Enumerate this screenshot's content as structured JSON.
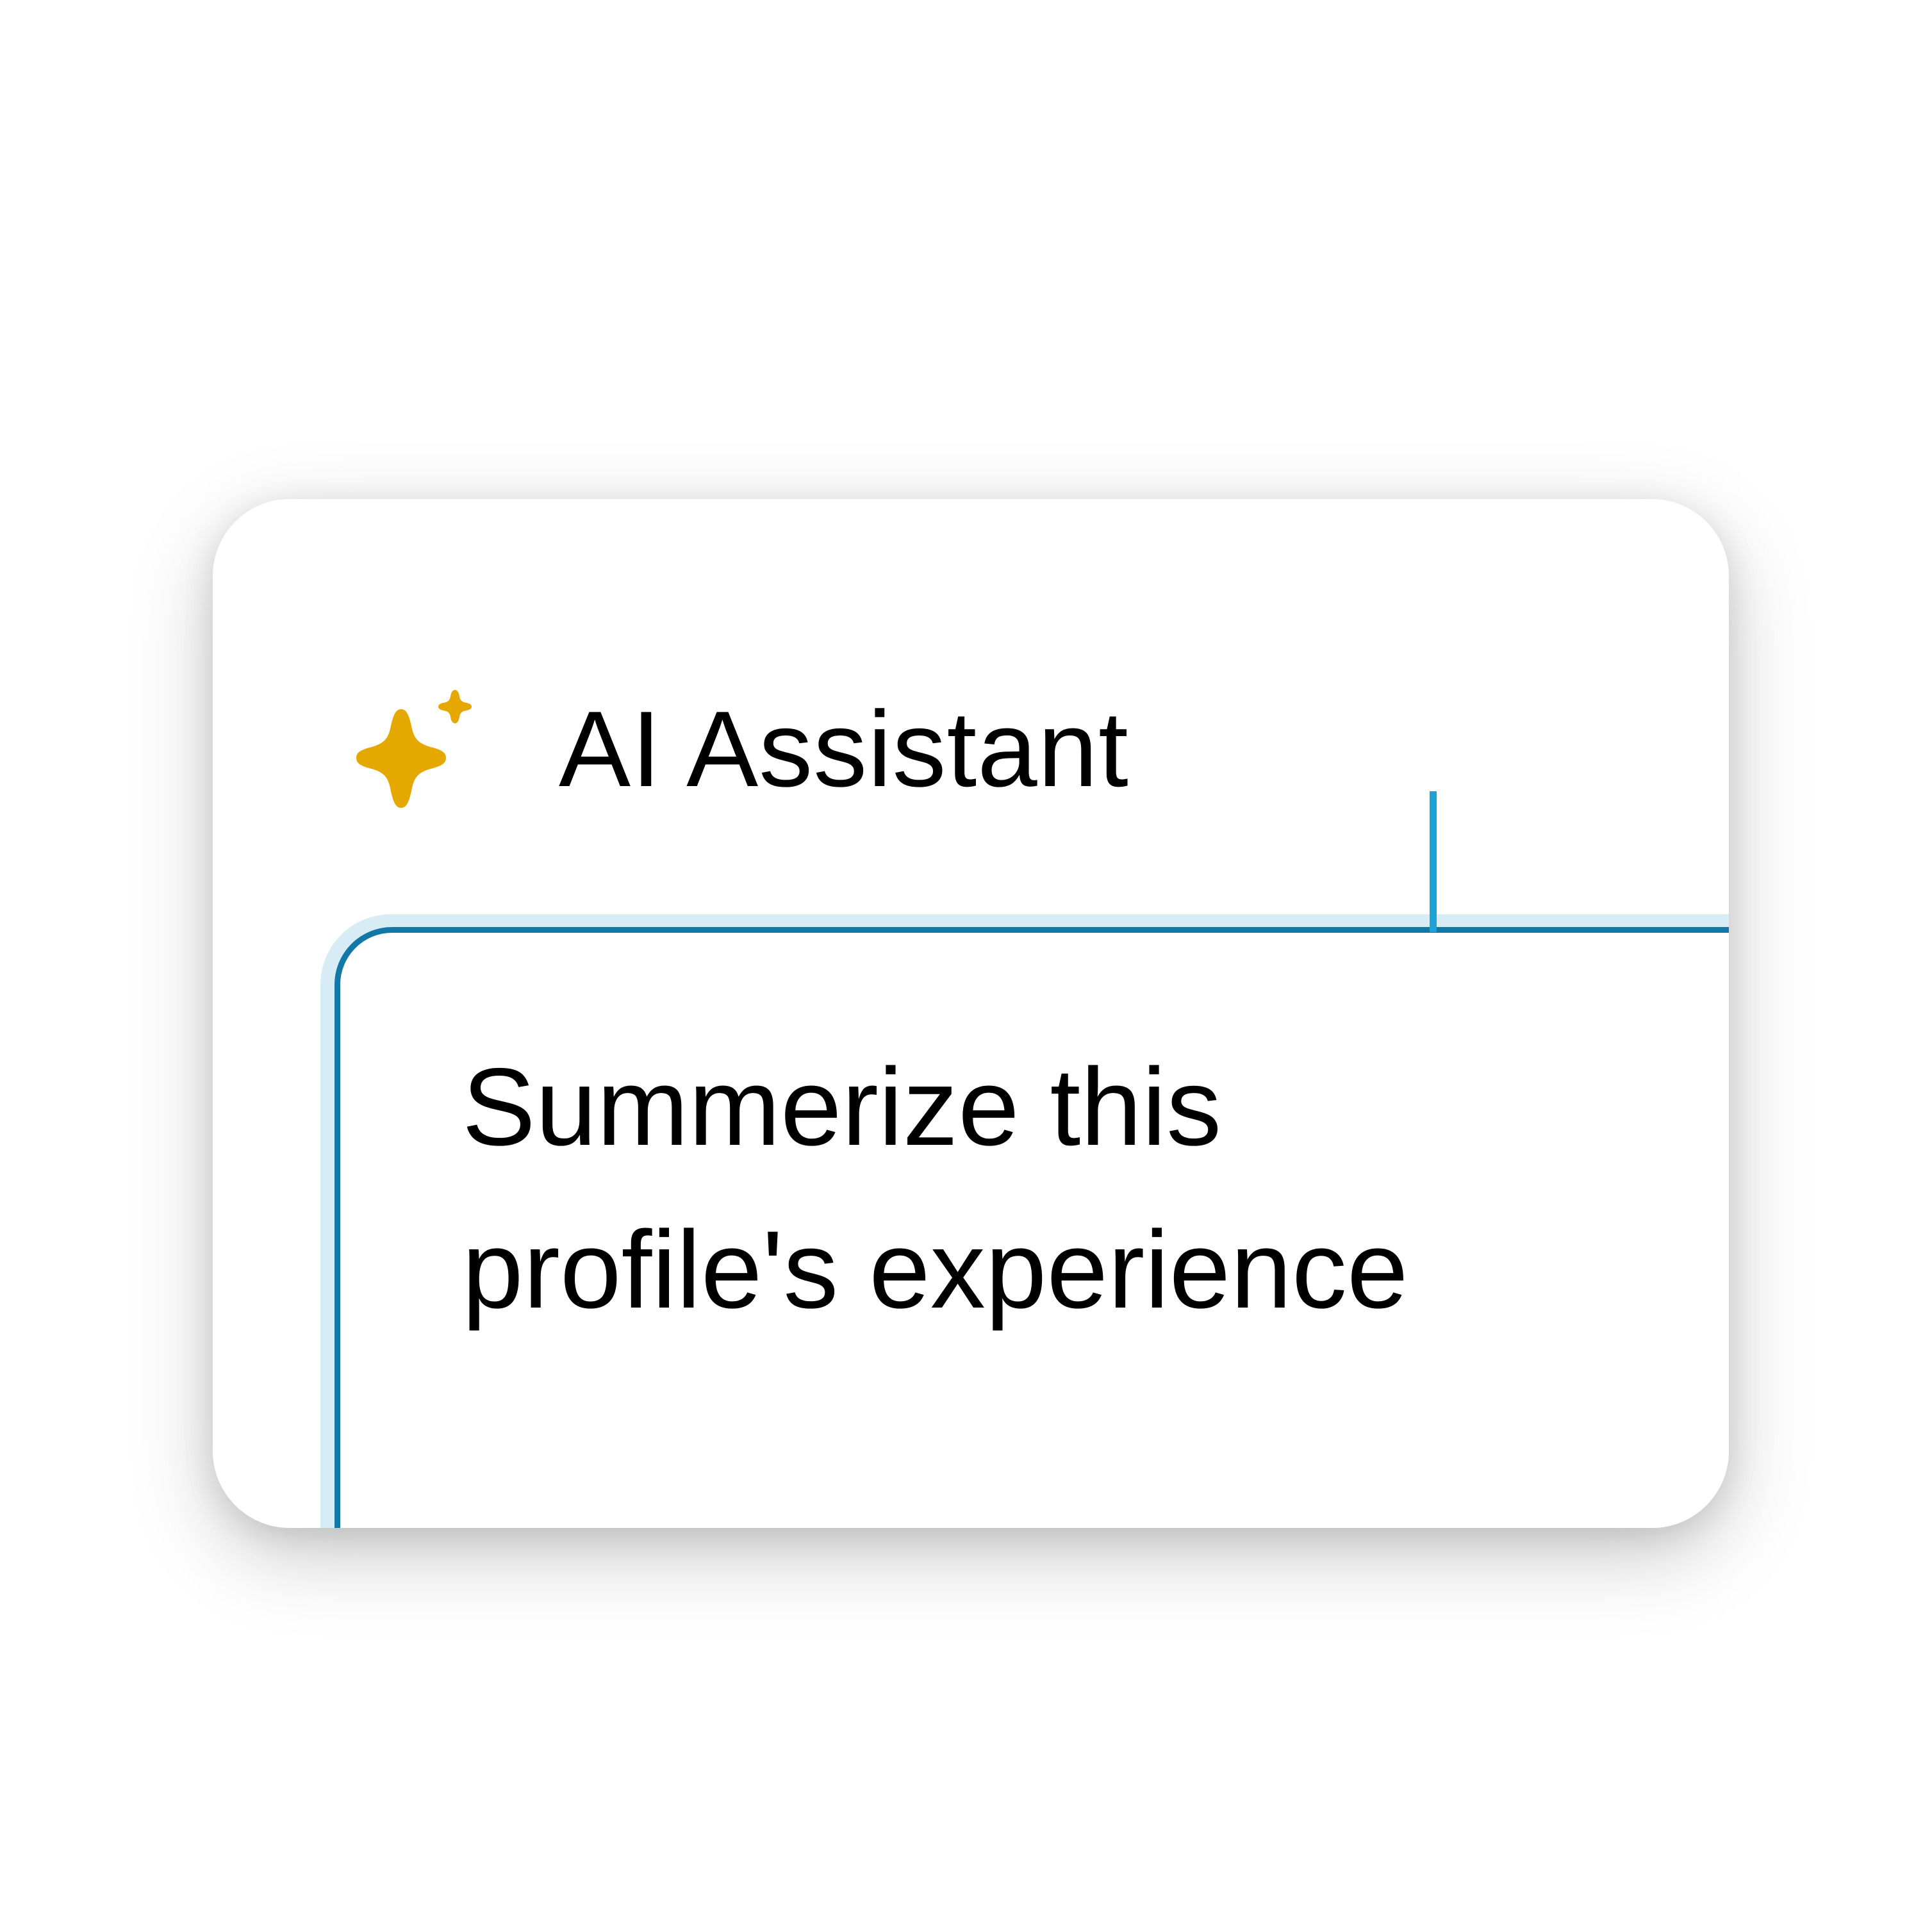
{
  "assistant": {
    "title": "AI Assistant",
    "icon": "sparkle-icon",
    "icon_color": "#E5A800"
  },
  "prompt_input": {
    "value_line1": "Summerize this",
    "value_line2": "profile's experience",
    "border_color": "#1478A6",
    "focus_ring_color": "#D7ECF5",
    "caret_color": "#1DA2D8"
  }
}
